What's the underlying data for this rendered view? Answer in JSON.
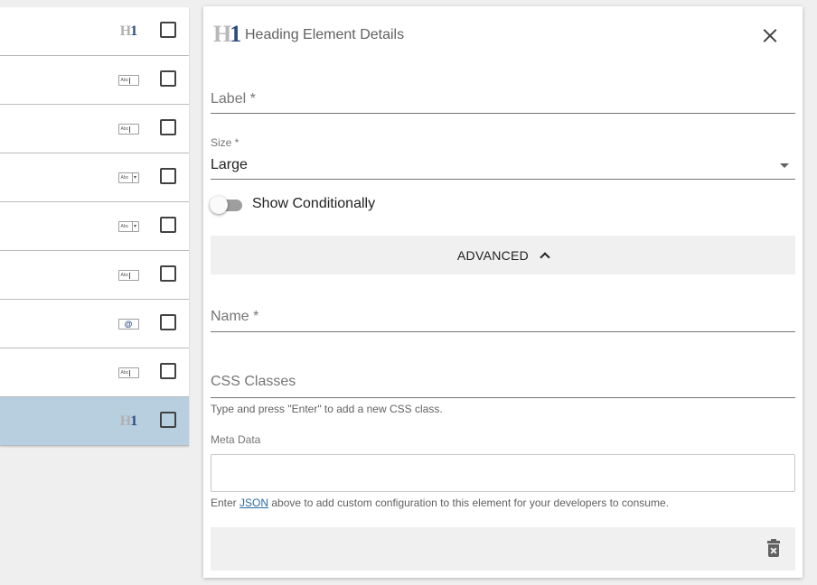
{
  "list": {
    "items": [
      {
        "icon": "heading-icon",
        "glyph_h": "H",
        "glyph_n": "1",
        "selected": false
      },
      {
        "icon": "text-field-icon",
        "glyph": "Abc",
        "selected": false
      },
      {
        "icon": "text-field-icon",
        "glyph": "Abc",
        "selected": false
      },
      {
        "icon": "dropdown-field-icon",
        "glyph": "Abc",
        "selected": false
      },
      {
        "icon": "dropdown-field-icon",
        "glyph": "Abc",
        "selected": false
      },
      {
        "icon": "text-field-icon",
        "glyph": "Abc",
        "selected": false
      },
      {
        "icon": "email-field-icon",
        "glyph": "@",
        "selected": false
      },
      {
        "icon": "text-field-icon",
        "glyph": "Abc",
        "selected": false
      },
      {
        "icon": "heading-icon",
        "glyph_h": "H",
        "glyph_n": "1",
        "selected": true
      }
    ]
  },
  "panel": {
    "icon_h": "H",
    "icon_n": "1",
    "title": "Heading Element Details",
    "label_field": {
      "placeholder": "Label *"
    },
    "size_field": {
      "label": "Size *",
      "value": "Large"
    },
    "show_conditionally": {
      "label": "Show Conditionally",
      "on": false
    },
    "advanced_label": "ADVANCED",
    "name_field": {
      "placeholder": "Name *"
    },
    "css_field": {
      "placeholder": "CSS Classes",
      "helper": "Type and press \"Enter\" to add a new CSS class."
    },
    "meta_data": {
      "label": "Meta Data",
      "helper_before": "Enter ",
      "helper_link": "JSON",
      "helper_after": " above to add custom configuration to this element for your developers to consume."
    }
  },
  "colors": {
    "selected_row": "#b8cfe0",
    "accent": "#2b4c7e",
    "link": "#2b6aa6"
  }
}
